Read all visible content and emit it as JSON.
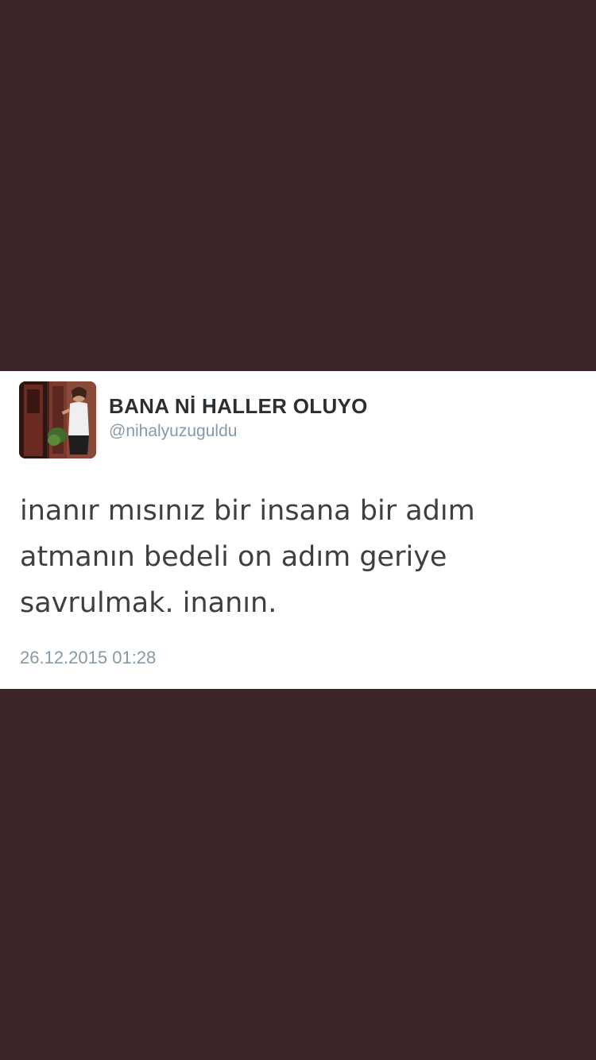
{
  "tweet": {
    "display_name": "BANA Nİ HALLER OLUYO",
    "handle": "@nihalyuzuguldu",
    "text_lines": [
      "inanır mısınız bir insana bir adım",
      "atmanın bedeli on adım geriye",
      "savrulmak. inanın."
    ],
    "timestamp": "26.12.2015 01:28"
  },
  "colors": {
    "background": "#3c2628",
    "card": "#ffffff",
    "name": "#292f33",
    "secondary": "#8899a6",
    "body_text": "#3d3f42"
  }
}
